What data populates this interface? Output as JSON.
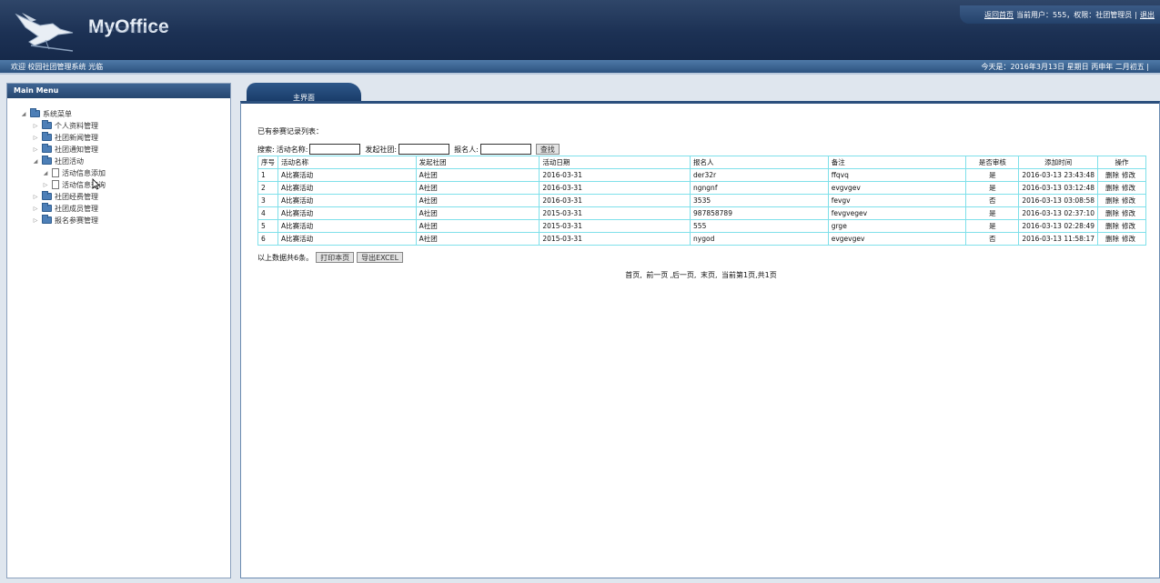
{
  "header": {
    "logo_text": "MyOffice",
    "topnav": {
      "home": "返回首页",
      "current_user": "当前用户：555，权限：社团管理员",
      "sep": "|",
      "logout": "退出"
    }
  },
  "subbar": {
    "welcome": "欢迎 校园社团管理系统 光临",
    "today": "今天是：2016年3月13日 星期日 丙申年 二月初五 |"
  },
  "sidebar": {
    "title": "Main Menu",
    "items": [
      {
        "label": "系统菜单"
      },
      {
        "label": "个人资料管理"
      },
      {
        "label": "社团新闻管理"
      },
      {
        "label": "社团通知管理"
      },
      {
        "label": "社团活动"
      },
      {
        "label": "活动信息添加"
      },
      {
        "label": "活动信息查询"
      },
      {
        "label": "社团经费管理"
      },
      {
        "label": "社团成员管理"
      },
      {
        "label": "报名参赛管理"
      }
    ]
  },
  "main": {
    "tab_label": "主界面",
    "heading": "已有参赛记录列表：",
    "search": {
      "label": "搜索:",
      "activity_label": "活动名称:",
      "club_label": "发起社团:",
      "signup_label": "报名人:",
      "button": "查找"
    },
    "table": {
      "headers": [
        "序号",
        "活动名称",
        "发起社团",
        "活动日期",
        "报名人",
        "备注",
        "是否审核",
        "添加时间",
        "操作"
      ],
      "rows": [
        [
          "1",
          "A比赛活动",
          "A社团",
          "2016-03-31",
          "der32r",
          "ffqvq",
          "是",
          "2016-03-13 23:43:48"
        ],
        [
          "2",
          "A比赛活动",
          "A社团",
          "2016-03-31",
          "ngngnf",
          "evgvgev",
          "是",
          "2016-03-13 03:12:48"
        ],
        [
          "3",
          "A比赛活动",
          "A社团",
          "2016-03-31",
          "3535",
          "fevgv",
          "否",
          "2016-03-13 03:08:58"
        ],
        [
          "4",
          "A比赛活动",
          "A社团",
          "2015-03-31",
          "987858789",
          "fevgvegev",
          "是",
          "2016-03-13 02:37:10"
        ],
        [
          "5",
          "A比赛活动",
          "A社团",
          "2015-03-31",
          "555",
          "grge",
          "是",
          "2016-03-13 02:28:49"
        ],
        [
          "6",
          "A比赛活动",
          "A社团",
          "2015-03-31",
          "nygod",
          "evgevgev",
          "否",
          "2016-03-13 11:58:17"
        ]
      ],
      "ops": {
        "delete": "删除",
        "edit": "修改"
      }
    },
    "summary": "以上数据共6条。",
    "print_button": "打印本页",
    "export_button": "导出EXCEL",
    "pager": {
      "first": "首页,",
      "prev": "前一页",
      "next": ",后一页,",
      "last": "末页,",
      "info": "当前第1页,共1页"
    }
  }
}
